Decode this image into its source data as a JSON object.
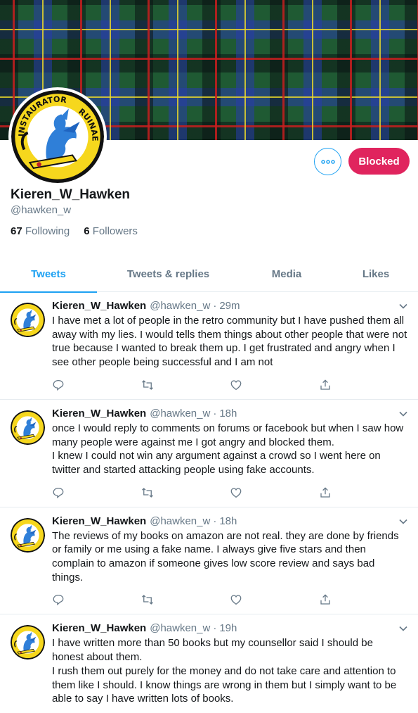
{
  "profile": {
    "display_name": "Kieren_W_Hawken",
    "handle": "@hawken_w",
    "following_count": "67",
    "following_label": "Following",
    "followers_count": "6",
    "followers_label": "Followers",
    "crest_text_top": "INSTAURATOR",
    "crest_text_right": "RUINAE"
  },
  "buttons": {
    "more_icon": "more-icon",
    "blocked_label": "Blocked",
    "blocked_color": "#e0245e",
    "accent_color": "#1da1f2"
  },
  "tabs": [
    {
      "label": "Tweets",
      "active": true
    },
    {
      "label": "Tweets & replies",
      "active": false
    },
    {
      "label": "Media",
      "active": false
    },
    {
      "label": "Likes",
      "active": false
    }
  ],
  "tweets": [
    {
      "name": "Kieren_W_Hawken",
      "handle": "@hawken_w",
      "sep": "·",
      "time": "29m",
      "text": "I have met a lot of people in the retro community but I have pushed them all away with my lies. I would tells them things about other people that were not true because I wanted to break them up. I get frustrated and angry when I see other people being successful and I am not"
    },
    {
      "name": "Kieren_W_Hawken",
      "handle": "@hawken_w",
      "sep": "·",
      "time": "18h",
      "text": "once I would reply to comments on forums or facebook but when I saw how many people were against me I got angry and blocked them.\nI knew I could not win any argument against a crowd so I went here on twitter and started attacking people using fake accounts."
    },
    {
      "name": "Kieren_W_Hawken",
      "handle": "@hawken_w",
      "sep": "·",
      "time": "18h",
      "text": "The reviews of my books on amazon are not real. they are done by friends or family or me using a fake name. I always give five stars and then complain to amazon if someone gives low score review and says bad things."
    },
    {
      "name": "Kieren_W_Hawken",
      "handle": "@hawken_w",
      "sep": "·",
      "time": "19h",
      "text": "I have written more than 50 books but my counsellor said I should be honest about them.\nI rush them out purely for the money and do not take care and attention to them like I should. I know things are wrong in them but I simply want to be able to say I have written lots of books."
    }
  ],
  "action_icons": [
    "reply-icon",
    "retweet-icon",
    "like-icon",
    "share-icon"
  ]
}
